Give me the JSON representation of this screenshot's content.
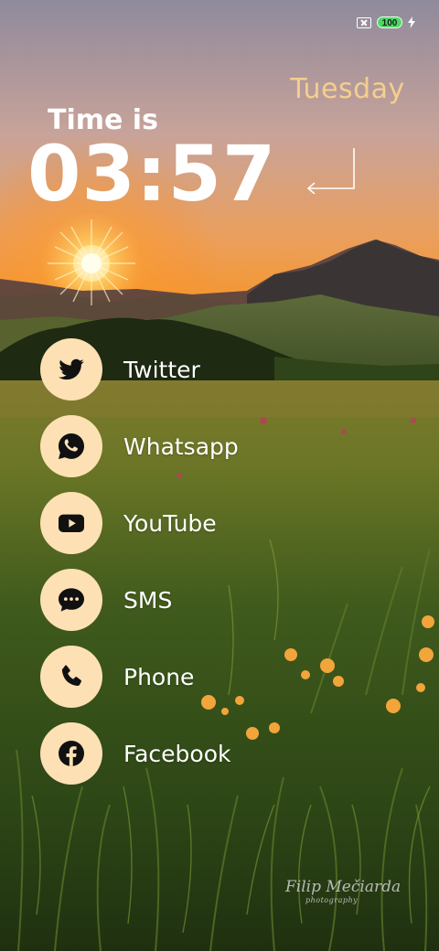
{
  "status_bar": {
    "sim_icon": "no-sim-icon",
    "battery_level": "100",
    "battery_color": "#4cd964",
    "charging_icon": "bolt-icon"
  },
  "clock": {
    "day": "Tuesday",
    "prefix": "Time is",
    "time": "03:57"
  },
  "accent_color": "#fde1b4",
  "day_color": "#f4cf8e",
  "apps": [
    {
      "label": "Twitter",
      "icon": "twitter-icon"
    },
    {
      "label": "Whatsapp",
      "icon": "whatsapp-icon"
    },
    {
      "label": "YouTube",
      "icon": "youtube-icon"
    },
    {
      "label": "SMS",
      "icon": "sms-icon"
    },
    {
      "label": "Phone",
      "icon": "phone-icon"
    },
    {
      "label": "Facebook",
      "icon": "facebook-icon"
    }
  ],
  "wallpaper": {
    "watermark_line1": "Filip Mečiarda",
    "watermark_line2": "photography"
  }
}
